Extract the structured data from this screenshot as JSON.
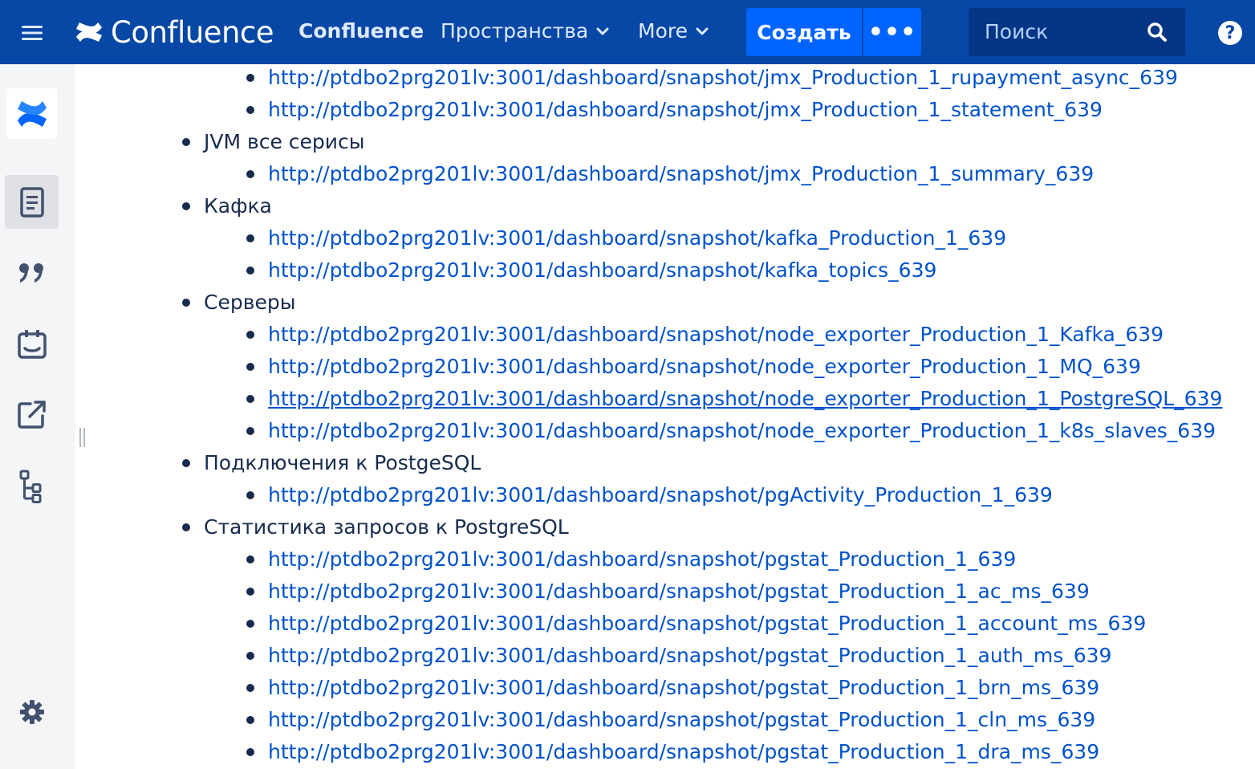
{
  "header": {
    "brand": "Confluence",
    "space": "Confluence",
    "nav_spaces": "Пространства",
    "nav_more": "More",
    "create_label": "Создать",
    "create_more": "•••",
    "search_placeholder": "Поиск",
    "help": "?"
  },
  "colors": {
    "topbar": "#0747a6",
    "create_button": "#0065ff",
    "link": "#0052cc",
    "text": "#172b4d",
    "sidebar": "#f4f5f7"
  },
  "sidebar": {
    "items": [
      {
        "icon": "confluence-logo-icon"
      },
      {
        "icon": "pages-icon",
        "active": true
      },
      {
        "icon": "quote-icon"
      },
      {
        "icon": "calendar-icon"
      },
      {
        "icon": "external-link-icon"
      },
      {
        "icon": "page-tree-icon"
      },
      {
        "icon": "settings-gear-icon"
      }
    ]
  },
  "content": {
    "items": [
      {
        "level": 2,
        "text": "http://ptdbo2prg201lv:3001/dashboard/snapshot/jmx_Production_1_rupayment_async_639"
      },
      {
        "level": 2,
        "text": "http://ptdbo2prg201lv:3001/dashboard/snapshot/jmx_Production_1_statement_639"
      },
      {
        "level": 1,
        "text": "JVM все серисы"
      },
      {
        "level": 2,
        "text": "http://ptdbo2prg201lv:3001/dashboard/snapshot/jmx_Production_1_summary_639"
      },
      {
        "level": 1,
        "text": "Кафка"
      },
      {
        "level": 2,
        "text": "http://ptdbo2prg201lv:3001/dashboard/snapshot/kafka_Production_1_639"
      },
      {
        "level": 2,
        "text": "http://ptdbo2prg201lv:3001/dashboard/snapshot/kafka_topics_639"
      },
      {
        "level": 1,
        "text": "Серверы"
      },
      {
        "level": 2,
        "text": "http://ptdbo2prg201lv:3001/dashboard/snapshot/node_exporter_Production_1_Kafka_639"
      },
      {
        "level": 2,
        "text": "http://ptdbo2prg201lv:3001/dashboard/snapshot/node_exporter_Production_1_MQ_639"
      },
      {
        "level": 2,
        "text": "http://ptdbo2prg201lv:3001/dashboard/snapshot/node_exporter_Production_1_PostgreSQL_639",
        "hovered": true
      },
      {
        "level": 2,
        "text": "http://ptdbo2prg201lv:3001/dashboard/snapshot/node_exporter_Production_1_k8s_slaves_639"
      },
      {
        "level": 1,
        "text": "Подключения к PostgeSQL"
      },
      {
        "level": 2,
        "text": "http://ptdbo2prg201lv:3001/dashboard/snapshot/pgActivity_Production_1_639"
      },
      {
        "level": 1,
        "text": "Статистика запросов к PostgreSQL"
      },
      {
        "level": 2,
        "text": "http://ptdbo2prg201lv:3001/dashboard/snapshot/pgstat_Production_1_639"
      },
      {
        "level": 2,
        "text": "http://ptdbo2prg201lv:3001/dashboard/snapshot/pgstat_Production_1_ac_ms_639"
      },
      {
        "level": 2,
        "text": "http://ptdbo2prg201lv:3001/dashboard/snapshot/pgstat_Production_1_account_ms_639"
      },
      {
        "level": 2,
        "text": "http://ptdbo2prg201lv:3001/dashboard/snapshot/pgstat_Production_1_auth_ms_639"
      },
      {
        "level": 2,
        "text": "http://ptdbo2prg201lv:3001/dashboard/snapshot/pgstat_Production_1_brn_ms_639"
      },
      {
        "level": 2,
        "text": "http://ptdbo2prg201lv:3001/dashboard/snapshot/pgstat_Production_1_cln_ms_639"
      },
      {
        "level": 2,
        "text": "http://ptdbo2prg201lv:3001/dashboard/snapshot/pgstat_Production_1_dra_ms_639"
      }
    ]
  }
}
